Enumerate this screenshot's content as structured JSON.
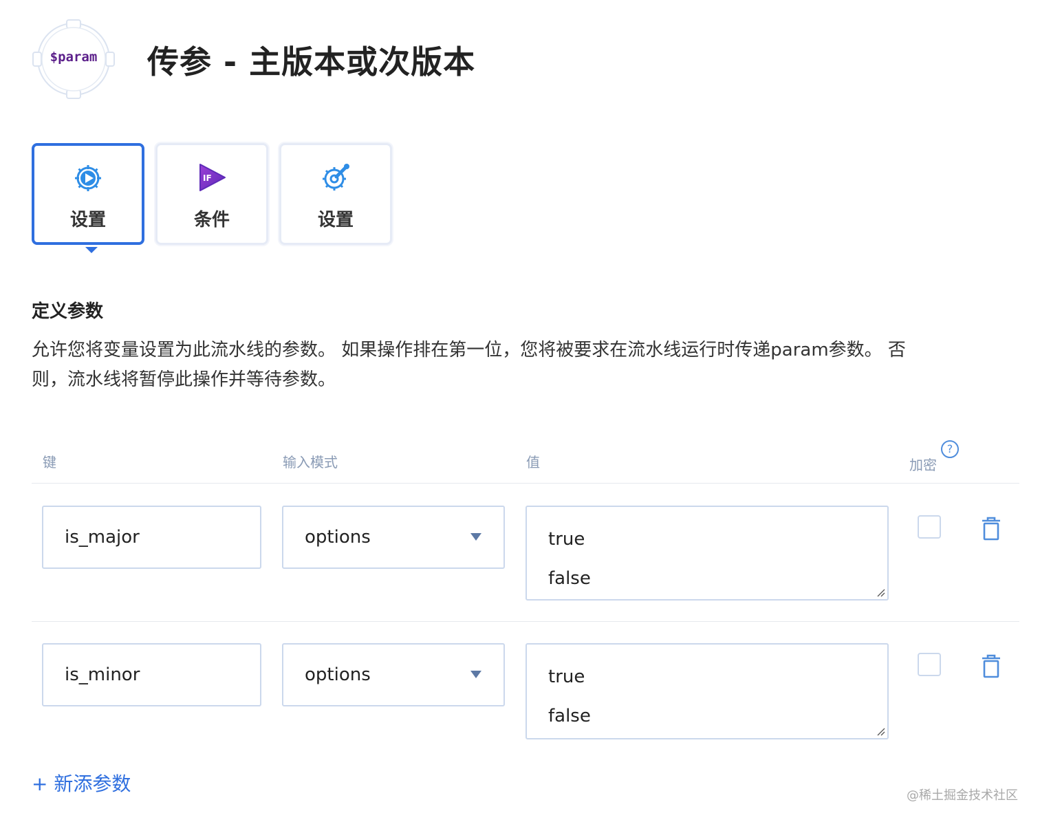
{
  "header": {
    "logo_text": "$param",
    "title": "传参 - 主版本或次版本"
  },
  "tabs": [
    {
      "label": "设置",
      "icon": "play-gear-icon",
      "active": true
    },
    {
      "label": "条件",
      "icon": "if-play-icon",
      "active": false
    },
    {
      "label": "设置",
      "icon": "wrench-gear-icon",
      "active": false
    }
  ],
  "section": {
    "title": "定义参数",
    "line1": "允许您将变量设置为此流水线的参数。 如果操作排在第一位，您将被要求在流水线运行时传递param参数。 否",
    "line2": "则，流水线将暂停此操作并等待参数。"
  },
  "table": {
    "headers": {
      "key": "键",
      "mode": "输入模式",
      "value": "值",
      "encrypt": "加密",
      "help": "?"
    },
    "rows": [
      {
        "key": "is_major",
        "mode": "options",
        "values": [
          "true",
          "false"
        ],
        "encrypted": false
      },
      {
        "key": "is_minor",
        "mode": "options",
        "values": [
          "true",
          "false"
        ],
        "encrypted": false
      }
    ]
  },
  "add_param_label": "+ 新添参数",
  "watermark": "@稀土掘金技术社区",
  "colors": {
    "accent": "#2f6fdf",
    "border": "#cbd8ec",
    "muted_header": "#8a9bb5",
    "logo_text": "#5b1f8a"
  }
}
